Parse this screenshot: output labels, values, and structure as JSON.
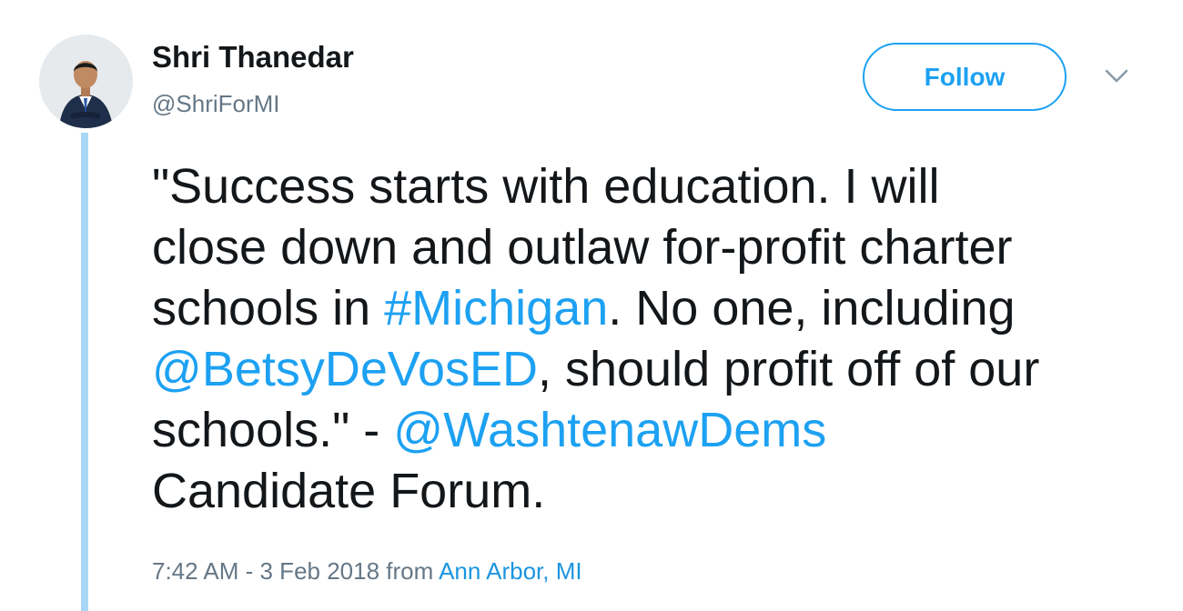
{
  "author": {
    "name": "Shri Thanedar",
    "handle": "@ShriForMI"
  },
  "actions": {
    "follow_label": "Follow",
    "menu_icon": "chevron-down-icon"
  },
  "tweet": {
    "lines": [
      [
        {
          "text": "\"Success starts with education. I will",
          "link": false
        }
      ],
      [
        {
          "text": "close down and outlaw for-profit charter",
          "link": false
        }
      ],
      [
        {
          "text": "schools in ",
          "link": false
        },
        {
          "text": "#Michigan",
          "link": true
        },
        {
          "text": ". No one, including",
          "link": false
        }
      ],
      [
        {
          "text": "@BetsyDeVosED",
          "link": true
        },
        {
          "text": ", should profit off of our",
          "link": false
        }
      ],
      [
        {
          "text": "schools.\" -  ",
          "link": false
        },
        {
          "text": "@WashtenawDems",
          "link": true
        }
      ],
      [
        {
          "text": "Candidate Forum.",
          "link": false
        }
      ]
    ]
  },
  "meta": {
    "timestamp": "7:42 AM - 3 Feb 2018",
    "from_label": " from ",
    "location": "Ann Arbor, MI"
  },
  "colors": {
    "accent": "#1da1f2",
    "text": "#14171a",
    "secondary": "#657786",
    "thread_line": "#a9d6f5"
  }
}
